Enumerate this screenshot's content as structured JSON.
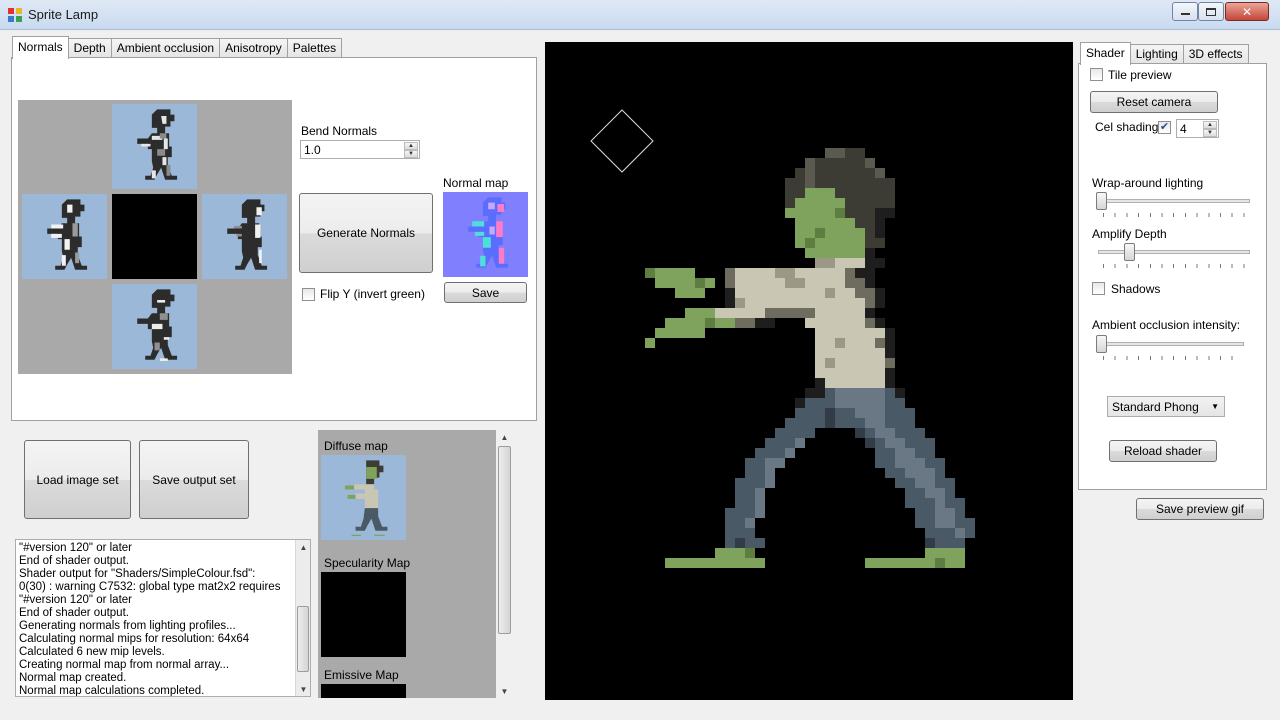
{
  "window": {
    "title": "Sprite Lamp"
  },
  "left_tabs": [
    {
      "label": "Normals",
      "active": true
    },
    {
      "label": "Depth",
      "active": false
    },
    {
      "label": "Ambient occlusion",
      "active": false
    },
    {
      "label": "Anisotropy",
      "active": false
    },
    {
      "label": "Palettes",
      "active": false
    }
  ],
  "normals": {
    "bend_label": "Bend Normals",
    "bend_value": "1.0",
    "generate_label": "Generate Normals",
    "normal_map_label": "Normal map",
    "save_label": "Save",
    "flip_label": "Flip Y (invert green)",
    "flip_checked": false
  },
  "actions": {
    "load_label": "Load image set",
    "save_output_label": "Save output set"
  },
  "log": [
    "\"#version 120\" or later",
    "End of shader output.",
    "Shader output for \"Shaders/SimpleColour.fsd\":",
    "0(30) : warning C7532: global type mat2x2 requires",
    "\"#version 120\" or later",
    "End of shader output.",
    "Generating normals from lighting profiles...",
    "Calculating normal mips for resolution: 64x64",
    "Calculated 6 new mip levels.",
    "Creating normal map from normal array...",
    "Normal map created.",
    "Normal map calculations completed."
  ],
  "maps": [
    {
      "label": "Diffuse map"
    },
    {
      "label": "Specularity Map"
    },
    {
      "label": "Emissive Map"
    }
  ],
  "right_tabs": [
    {
      "label": "Shader",
      "active": true
    },
    {
      "label": "Lighting",
      "active": false
    },
    {
      "label": "3D effects",
      "active": false
    }
  ],
  "shader": {
    "tile_preview_label": "Tile preview",
    "tile_preview_checked": false,
    "reset_camera_label": "Reset camera",
    "cel_shading_label": "Cel shading",
    "cel_shading_checked": true,
    "cel_levels": "4",
    "wrap_label": "Wrap-around lighting",
    "wrap_value": 0,
    "amplify_label": "Amplify Depth",
    "amplify_value": 0.2,
    "shadows_label": "Shadows",
    "shadows_checked": false,
    "ao_label": "Ambient occlusion intensity:",
    "ao_value": 0,
    "shader_select": "Standard Phong",
    "reload_label": "Reload shader"
  },
  "save_gif_label": "Save preview gif",
  "colors": {
    "sprite_bg": "#9cb8d8",
    "zombie_skin": "#7fa35c",
    "zombie_shirt": "#c9c6b4",
    "zombie_pants": "#4a5966",
    "zombie_hair": "#3c3c34"
  }
}
